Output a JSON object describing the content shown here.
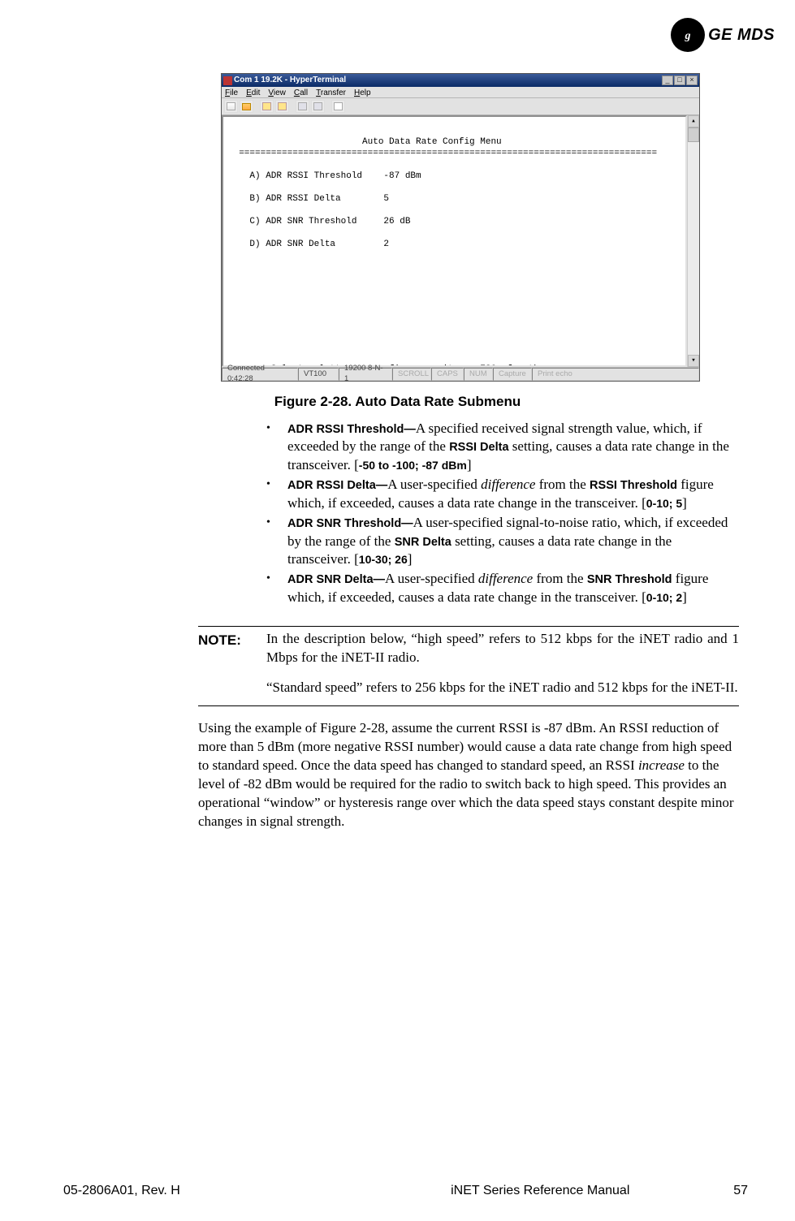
{
  "logo": {
    "monogram": "⌘",
    "brand": "GE MDS"
  },
  "terminal": {
    "title": "Com 1 19.2K - HyperTerminal",
    "menus": [
      "File",
      "Edit",
      "View",
      "Call",
      "Transfer",
      "Help"
    ],
    "status": {
      "connected": "Connected 0:42:28",
      "emulation": "VT100",
      "port": "19200 8-N-1",
      "scroll": "SCROLL",
      "caps": "CAPS",
      "num": "NUM",
      "capture": "Capture",
      "echo": "Print echo"
    },
    "screen_title": "Auto Data Rate Config Menu",
    "rule": "==============================================================================",
    "rows": [
      {
        "key": "A) ADR RSSI Threshold",
        "val": "-87 dBm"
      },
      {
        "key": "B) ADR RSSI Delta",
        "val": "5"
      },
      {
        "key": "C) ADR SNR Threshold",
        "val": "26 dB"
      },
      {
        "key": "D) ADR SNR Delta",
        "val": "2"
      }
    ],
    "prompt": "Select a letter to configure an item, <ESC> for the prev menu"
  },
  "figure_caption": "Figure 2-28. Auto Data Rate Submenu",
  "bullets": [
    {
      "label": "ADR RSSI Threshold—",
      "text1": "A specified received signal strength value, which, if exceeded by the range of the ",
      "inline_sans": "RSSI Delta",
      "text2": " set­ting, causes a data rate change in the transceiver. [",
      "range": "-50 to -100; -87 dBm",
      "text3": "]"
    },
    {
      "label": "ADR RSSI Delta—",
      "text1": "A user-specified ",
      "italic": "difference",
      "text1b": " from the ",
      "inline_sans": "RSSI Threshold",
      "text2": " figure which, if exceeded, causes a data rate change in the transceiver. [",
      "range": "0-10; 5",
      "text3": "]"
    },
    {
      "label": "ADR SNR Threshold—",
      "text1": "A user-specified signal-to-noise ratio, which, if exceeded by the range of the ",
      "inline_sans": "SNR Delta",
      "text2": " setting, causes a data rate change in the transceiver. [",
      "range": "10-30; 26",
      "text3": "]"
    },
    {
      "label": "ADR SNR Delta—",
      "text1": "A user-specified ",
      "italic": "difference",
      "text1b": " from the ",
      "inline_sans": "SNR Threshold",
      "text2": " figure which, if exceeded, causes a data rate change in the transceiver. [",
      "range": "0-10; 2",
      "text3": "]"
    }
  ],
  "note": {
    "label": "NOTE:",
    "p1": "In the description below, “high speed” refers to 512 kbps for the iNET radio and 1 Mbps for the iNET-II radio.",
    "p2": "“Standard speed” refers to 256 kbps for the iNET radio and 512 kbps for the iNET-II."
  },
  "paragraph": {
    "pre": "Using the example of Figure 2-28, assume the current RSSI is -87 dBm. An RSSI reduction of more than 5 dBm (more negative RSSI number) would cause a data rate change from high speed to standard speed. Once the data speed has changed to standard speed, an RSSI ",
    "italic": "increase",
    "post": " to the level of -82 dBm would be required for the radio to switch back to high speed. This provides an operational “window” or hysteresis range over which the data speed stays constant despite minor changes in signal strength."
  },
  "footer": {
    "doc_id": "05-2806A01, Rev. H",
    "doc_name": "iNET Series Reference Manual",
    "page": "57"
  }
}
